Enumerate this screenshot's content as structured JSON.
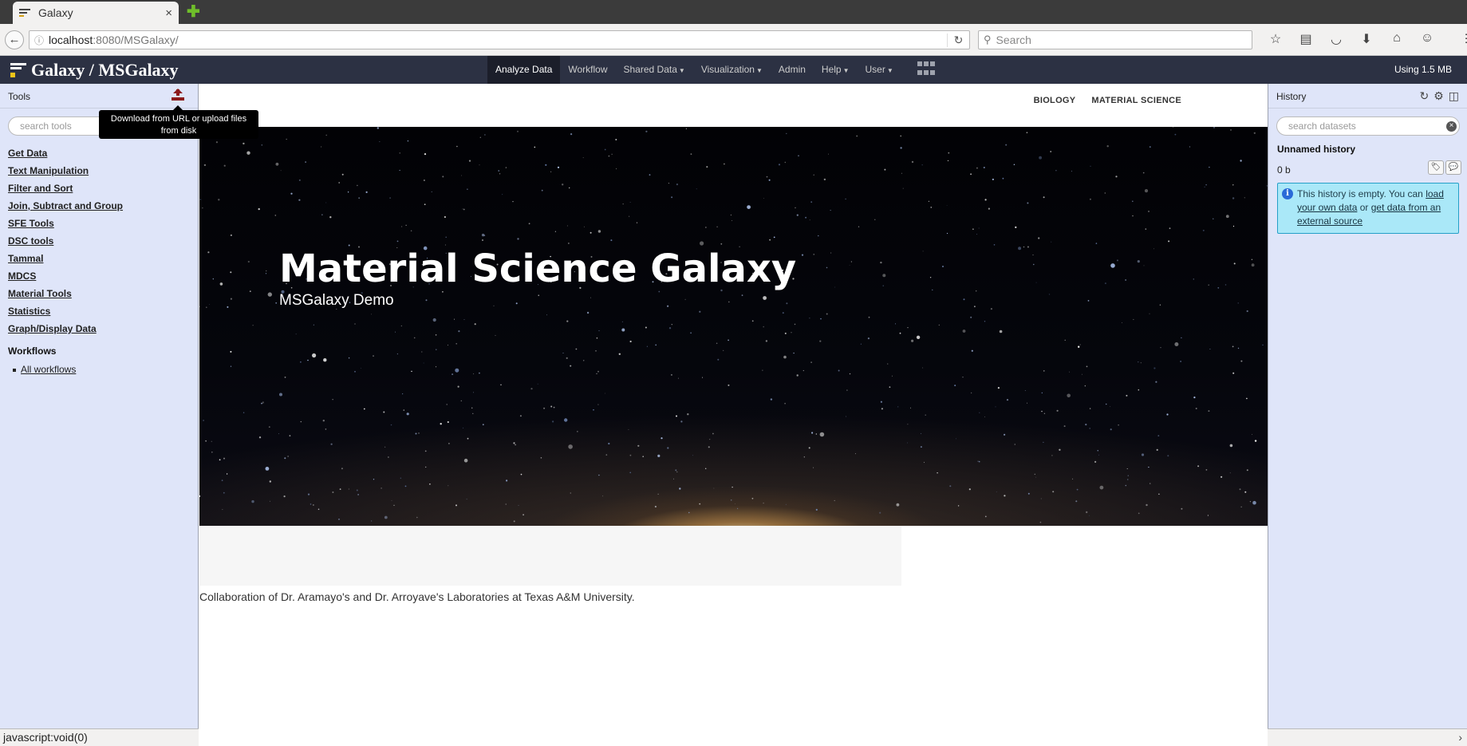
{
  "browser": {
    "tab_title": "Galaxy",
    "tab_close": "×",
    "new_tab": "✚",
    "url_host": "localhost",
    "url_rest": ":8080/MSGalaxy/",
    "search_placeholder": "Search",
    "status_text": "javascript:void(0)"
  },
  "masthead": {
    "brand": "Galaxy / MSGalaxy",
    "nav": [
      {
        "label": "Analyze Data",
        "active": true
      },
      {
        "label": "Workflow"
      },
      {
        "label": "Shared Data",
        "dropdown": true
      },
      {
        "label": "Visualization",
        "dropdown": true
      },
      {
        "label": "Admin"
      },
      {
        "label": "Help",
        "dropdown": true
      },
      {
        "label": "User",
        "dropdown": true
      }
    ],
    "quota": "Using 1.5 MB"
  },
  "tools": {
    "title": "Tools",
    "search_placeholder": "search tools",
    "upload_tooltip": "Download from URL or upload files from disk",
    "sections": [
      "Get Data",
      "Text Manipulation",
      "Filter and Sort",
      "Join, Subtract and Group",
      "SFE Tools",
      "DSC tools",
      "Tammal",
      "MDCS",
      "Material Tools",
      "Statistics",
      "Graph/Display Data"
    ],
    "workflows_title": "Workflows",
    "workflows_link": "All workflows"
  },
  "center": {
    "links": [
      "BIOLOGY",
      "MATERIAL SCIENCE"
    ],
    "hero_title": "Material Science Galaxy",
    "hero_subtitle": "MSGalaxy Demo",
    "footer": "Collaboration of Dr. Aramayo's and Dr. Arroyave's Laboratories at Texas A&M University."
  },
  "history": {
    "title": "History",
    "search_placeholder": "search datasets",
    "name": "Unnamed history",
    "size": "0 b",
    "empty_msg_prefix": "This history is empty. You can ",
    "empty_link1": "load your own data",
    "empty_msg_mid": " or ",
    "empty_link2": "get data from an external source"
  },
  "colors": {
    "masthead": "#2c3143",
    "panel": "#dfe5f9",
    "info_bg": "#aae8f8"
  }
}
